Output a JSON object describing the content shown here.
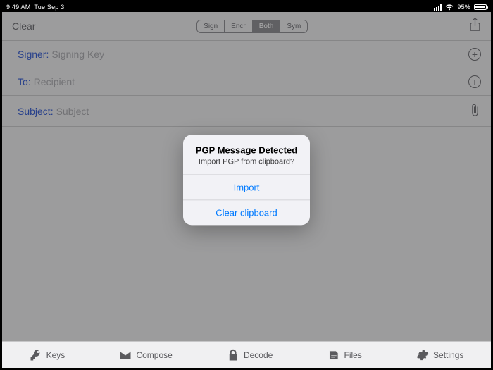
{
  "statusbar": {
    "time": "9:49 AM",
    "date": "Tue Sep 3",
    "battery_pct": "95%"
  },
  "topbar": {
    "clear": "Clear",
    "segments": {
      "sign": "Sign",
      "encr": "Encr",
      "both": "Both",
      "sym": "Sym"
    }
  },
  "rows": {
    "signer_label": "Signer:",
    "signer_placeholder": "Signing Key",
    "to_label": "To:",
    "to_placeholder": "Recipient",
    "subject_label": "Subject:",
    "subject_placeholder": "Subject"
  },
  "modal": {
    "title": "PGP Message Detected",
    "subtitle": "Import PGP from clipboard?",
    "import": "Import",
    "clear": "Clear clipboard"
  },
  "tabs": {
    "keys": "Keys",
    "compose": "Compose",
    "decode": "Decode",
    "files": "Files",
    "settings": "Settings"
  }
}
